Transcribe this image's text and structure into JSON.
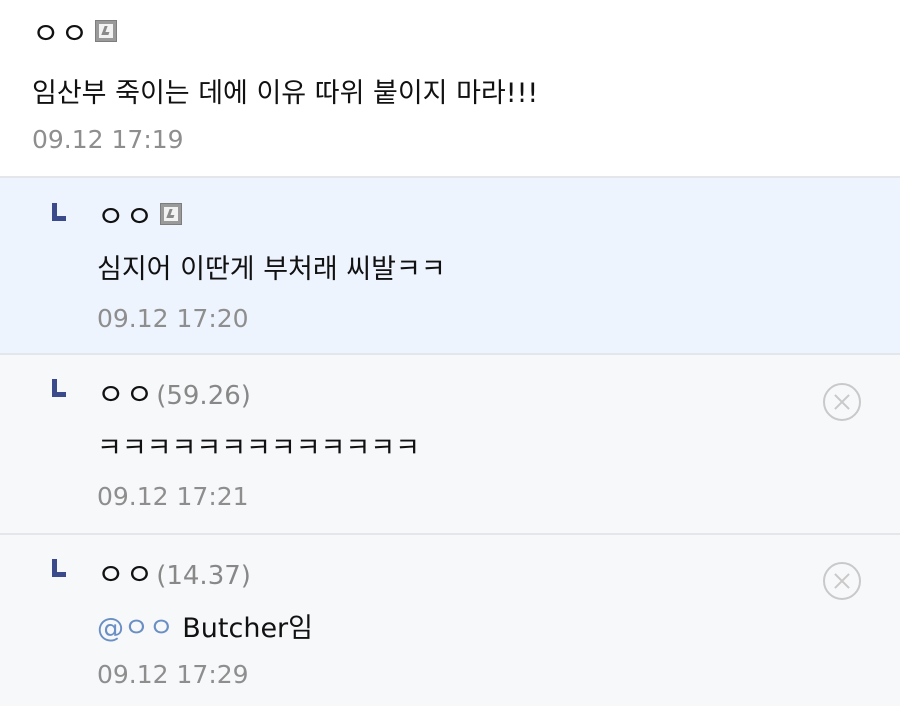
{
  "comments": [
    {
      "nick": "ㅇㅇ",
      "ip": "",
      "text": "임산부 죽이는 데에 이유 따위 붙이지 마라!!!",
      "time": "09.12 17:19"
    },
    {
      "nick": "ㅇㅇ",
      "ip": "",
      "text": "심지어 이딴게 부처래 씨발ㅋㅋ",
      "time": "09.12 17:20"
    },
    {
      "nick": "ㅇㅇ",
      "ip": "(59.26)",
      "text": "ㅋㅋㅋㅋㅋㅋㅋㅋㅋㅋㅋㅋㅋ",
      "time": "09.12 17:21"
    },
    {
      "nick": "ㅇㅇ",
      "ip": "(14.37)",
      "mention": "@ㅇㅇ",
      "text": " Butcher임",
      "time": "09.12 17:29"
    }
  ]
}
